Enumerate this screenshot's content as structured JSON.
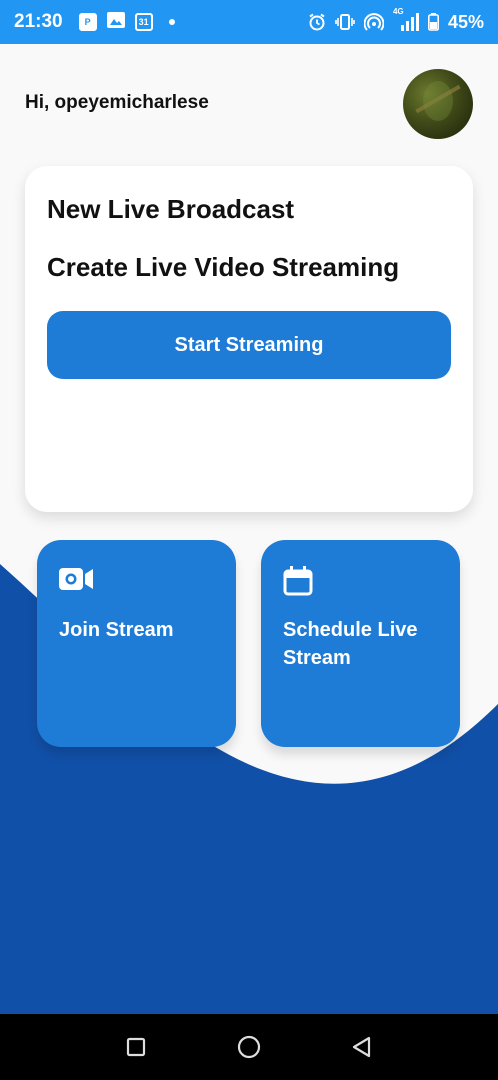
{
  "status_bar": {
    "time": "21:30",
    "calendar_day": "31",
    "network": "4G",
    "battery": "45%"
  },
  "header": {
    "greeting": "Hi, opeyemicharlese"
  },
  "broadcast_card": {
    "title": "New Live Broadcast",
    "subtitle": "Create Live Video Streaming",
    "start_button": "Start Streaming"
  },
  "tiles": {
    "join": {
      "label": "Join Stream",
      "icon": "video-camera-icon"
    },
    "schedule": {
      "label": "Schedule Live Stream",
      "icon": "calendar-icon"
    }
  },
  "nav": {
    "recents": "square-icon",
    "home": "circle-icon",
    "back": "triangle-back-icon"
  },
  "colors": {
    "status_bar": "#2196f3",
    "primary": "#1e7bd6",
    "wave": "#1150a8",
    "background": "#f9f9f9"
  }
}
